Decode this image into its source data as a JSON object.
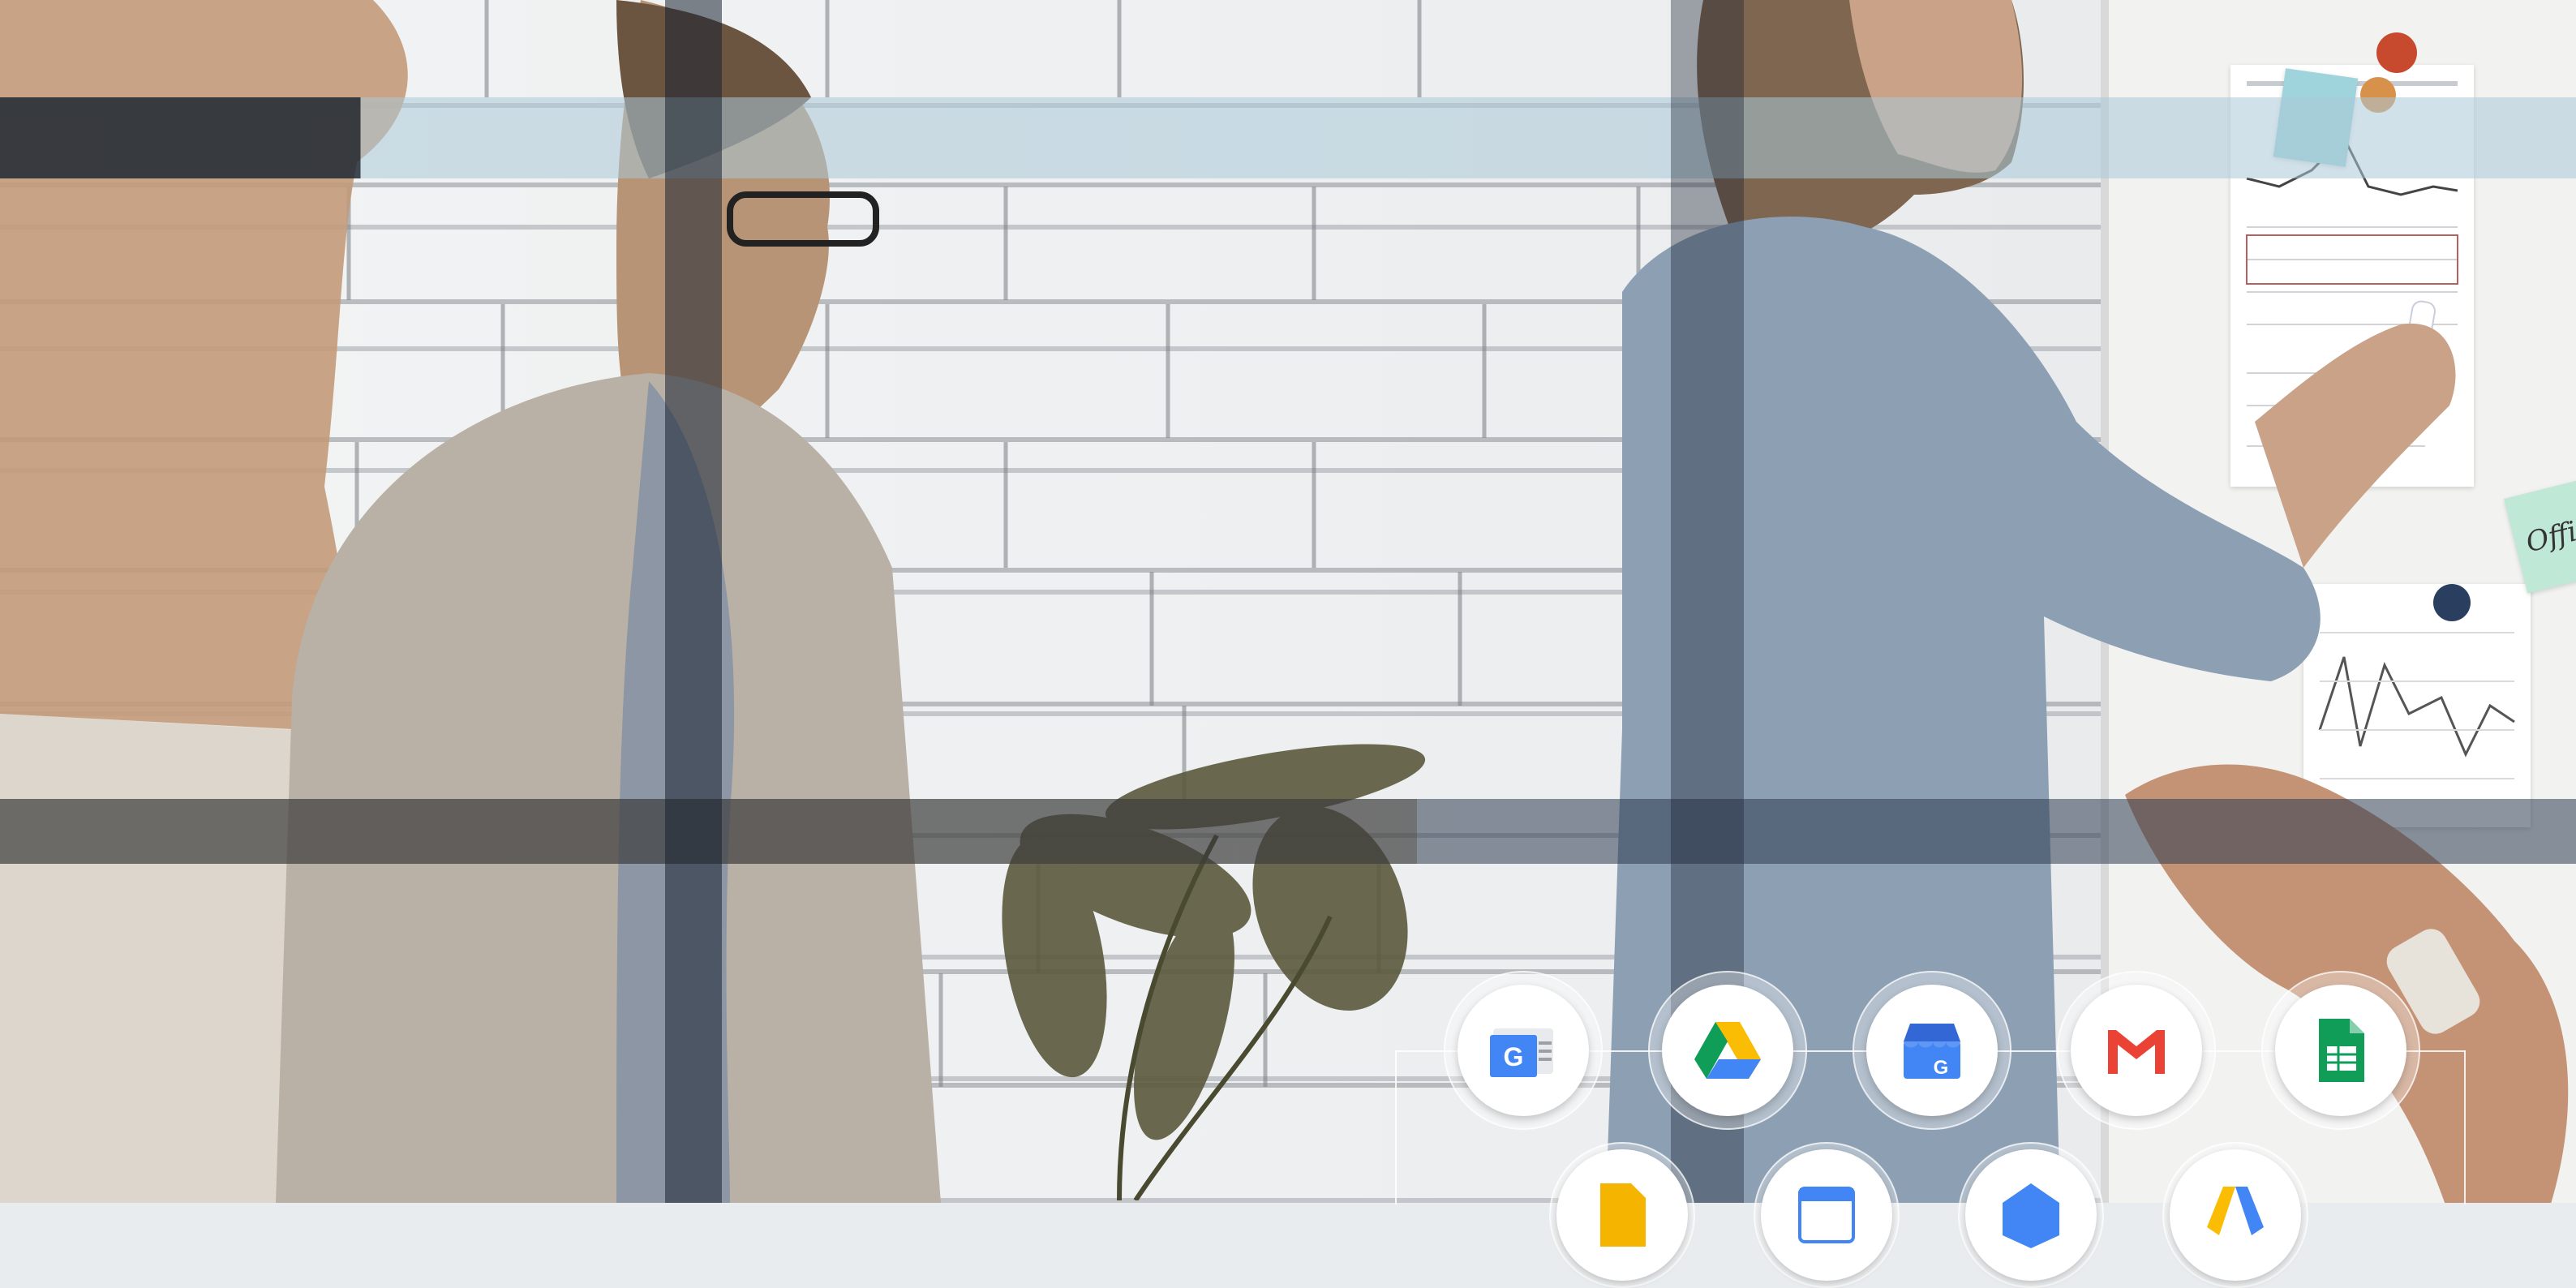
{
  "scene": {
    "description_icon": "office-meeting-photo"
  },
  "apps": {
    "row1": [
      {
        "name": "google-news-icon",
        "color": "#4285F4"
      },
      {
        "name": "google-drive-icon",
        "color": "#0F9D58"
      },
      {
        "name": "google-my-business-icon",
        "color": "#4285F4"
      },
      {
        "name": "gmail-icon",
        "color": "#EA4335"
      },
      {
        "name": "google-sheets-icon",
        "color": "#0F9D58"
      }
    ],
    "row2_partial": [
      {
        "name": "google-slides-icon",
        "color": "#F4B400"
      },
      {
        "name": "google-calendar-icon",
        "color": "#4285F4"
      },
      {
        "name": "google-tag-icon",
        "color": "#4285F4"
      },
      {
        "name": "google-ads-icon",
        "color": "#4285F4"
      }
    ]
  },
  "whiteboard_note": "Offic"
}
